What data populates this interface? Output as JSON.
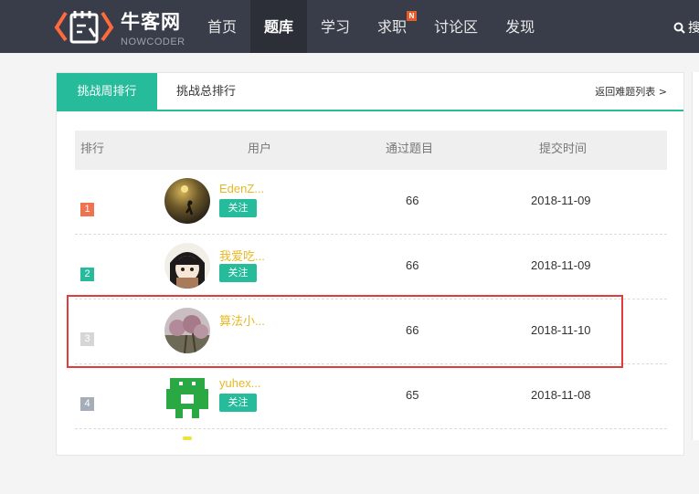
{
  "brand": {
    "name": "牛客网",
    "sub": "NOWCODER"
  },
  "nav": [
    {
      "label": "首页",
      "active": false,
      "badge": ""
    },
    {
      "label": "题库",
      "active": true,
      "badge": ""
    },
    {
      "label": "学习",
      "active": false,
      "badge": ""
    },
    {
      "label": "求职",
      "active": false,
      "badge": "N"
    },
    {
      "label": "讨论区",
      "active": false,
      "badge": ""
    },
    {
      "label": "发现",
      "active": false,
      "badge": ""
    }
  ],
  "search": {
    "label": "搜"
  },
  "tabs": {
    "week": "挑战周排行",
    "total": "挑战总排行",
    "back": "返回难题列表 >"
  },
  "table": {
    "headers": {
      "rank": "排行",
      "user": "用户",
      "passed": "通过题目",
      "time": "提交时间"
    },
    "rows": [
      {
        "rank": "1",
        "rank_color": "#f0734f",
        "user": "EdenZ...",
        "follow": "关注",
        "passed": "66",
        "time": "2018-11-09"
      },
      {
        "rank": "2",
        "rank_color": "#25bb9b",
        "user": "我爱吃...",
        "follow": "关注",
        "passed": "66",
        "time": "2018-11-09"
      },
      {
        "rank": "3",
        "rank_color": "#d6d6d6",
        "user": "算法小...",
        "follow": "",
        "passed": "66",
        "time": "2018-11-10"
      },
      {
        "rank": "4",
        "rank_color": "#a4adb8",
        "user": "yuhex...",
        "follow": "关注",
        "passed": "65",
        "time": "2018-11-08"
      }
    ]
  }
}
